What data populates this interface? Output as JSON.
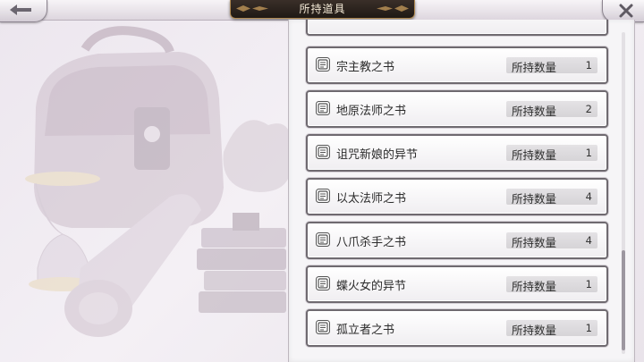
{
  "header": {
    "title": "所持道具",
    "back_icon": "arrow-left-icon",
    "close_icon": "close-x-icon"
  },
  "inventory": {
    "quantity_label": "所持数量",
    "item_icon": "book-icon",
    "items": [
      {
        "name": "宗主教之书",
        "quantity": "1"
      },
      {
        "name": "地原法师之书",
        "quantity": "2"
      },
      {
        "name": "诅咒新娘的异节",
        "quantity": "1"
      },
      {
        "name": "以太法师之书",
        "quantity": "4"
      },
      {
        "name": "八爪杀手之书",
        "quantity": "4"
      },
      {
        "name": "蝶火女的异节",
        "quantity": "1"
      },
      {
        "name": "孤立者之书",
        "quantity": "1"
      }
    ]
  },
  "colors": {
    "title_plate": "#2b221d",
    "title_border": "#b08a52",
    "item_border": "#6f6a70",
    "background": "#ece6ee"
  }
}
